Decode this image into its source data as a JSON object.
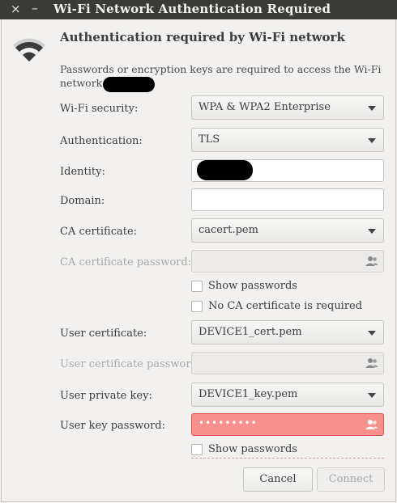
{
  "window": {
    "title": "Wi-Fi Network Authentication Required",
    "close_glyph": "×",
    "minimize_glyph": "–"
  },
  "header": {
    "icon": "wifi-signal-icon",
    "heading": "Authentication required by Wi-Fi network",
    "description": "Passwords or encryption keys are required to access the Wi-Fi network"
  },
  "form": {
    "wifi_security": {
      "label": "Wi-Fi security:",
      "value": "WPA & WPA2 Enterprise"
    },
    "authentication": {
      "label": "Authentication:",
      "value": "TLS"
    },
    "identity": {
      "label": "Identity:",
      "value": ""
    },
    "domain": {
      "label": "Domain:",
      "value": ""
    },
    "ca_certificate": {
      "label": "CA certificate:",
      "value": "cacert.pem"
    },
    "ca_cert_password": {
      "label": "CA certificate password:",
      "value": ""
    },
    "show_passwords_1": {
      "label": "Show passwords",
      "checked": false
    },
    "no_ca_required": {
      "label": "No CA certificate is required",
      "checked": false
    },
    "user_certificate": {
      "label": "User certificate:",
      "value": "DEVICE1_cert.pem"
    },
    "user_cert_password": {
      "label": "User certificate password:",
      "value": ""
    },
    "user_private_key": {
      "label": "User private key:",
      "value": "DEVICE1_key.pem"
    },
    "user_key_password": {
      "label": "User key password:",
      "value": "•••••••••"
    },
    "show_passwords_2": {
      "label": "Show passwords",
      "checked": false
    }
  },
  "buttons": {
    "cancel": "Cancel",
    "connect": "Connect"
  },
  "colors": {
    "titlebar": "#3a3a37",
    "error_field": "#f8908c",
    "dialog_bg": "#f2f1ef"
  }
}
